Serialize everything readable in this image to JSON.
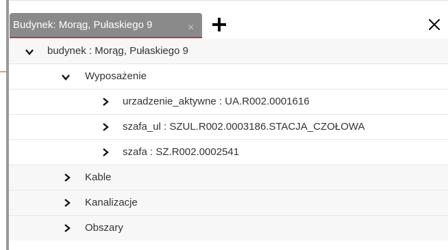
{
  "tab": {
    "label": "Budynek: Morąg, Pułaskiego 9",
    "close_glyph": "×"
  },
  "toolbar": {
    "add_tab_icon": "plus-icon",
    "close_all_icon": "close-icon"
  },
  "tree": {
    "root": {
      "label": "budynek : Morąg, Pułaskiego 9",
      "expanded": true
    },
    "equipment": {
      "label": "Wyposażenie",
      "expanded": true
    },
    "equipment_items": [
      {
        "label": "urzadzenie_aktywne : UA.R002.0001616"
      },
      {
        "label": "szafa_ul : SZUL.R002.0003186.STACJA_CZOŁOWA"
      },
      {
        "label": "szafa : SZ.R002.0002541"
      }
    ],
    "groups": [
      {
        "label": "Kable"
      },
      {
        "label": "Kanalizacje"
      },
      {
        "label": "Obszary"
      }
    ]
  },
  "colors": {
    "tab_bg": "#8a8a8a",
    "tab_underline": "#d32f2f",
    "left_border": "#9a9a9a",
    "accent_orange": "#e8a04c"
  }
}
